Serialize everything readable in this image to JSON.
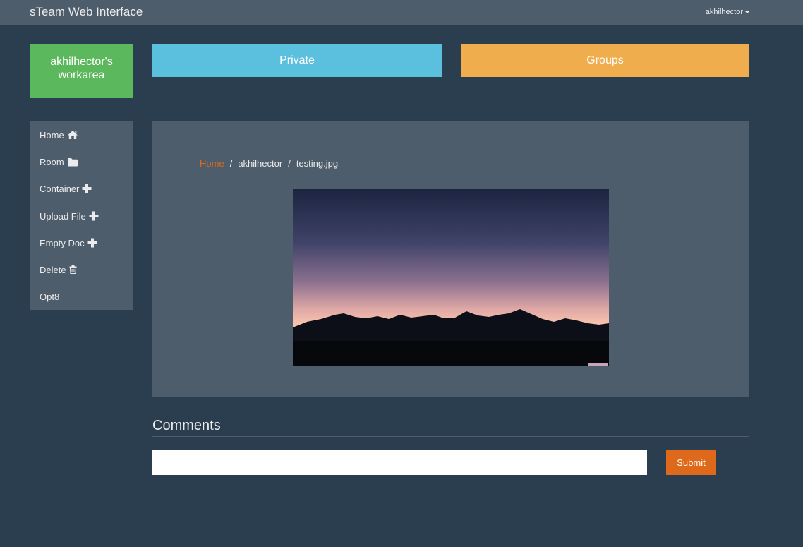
{
  "navbar": {
    "brand": "sTeam Web Interface",
    "user": "akhilhector"
  },
  "workarea": {
    "label": "akhilhector's workarea"
  },
  "tiles": {
    "private": "Private",
    "groups": "Groups"
  },
  "sidebar": {
    "items": [
      {
        "label": "Home",
        "icon": "home-icon"
      },
      {
        "label": "Room",
        "icon": "folder-icon"
      },
      {
        "label": "Container",
        "icon": "plus-icon"
      },
      {
        "label": "Upload File",
        "icon": "plus-icon"
      },
      {
        "label": "Empty Doc",
        "icon": "plus-icon"
      },
      {
        "label": "Delete",
        "icon": "trash-icon"
      },
      {
        "label": "Opt8",
        "icon": ""
      }
    ]
  },
  "breadcrumb": {
    "items": [
      "Home",
      "akhilhector",
      "testing.jpg"
    ],
    "separator": "/"
  },
  "comments": {
    "title": "Comments",
    "input_value": "",
    "submit_label": "Submit"
  },
  "colors": {
    "background": "#2b3e50",
    "panel": "#4e5d6c",
    "workarea": "#5cb85c",
    "private": "#5bc0de",
    "groups": "#f0ad4e",
    "accent": "#df691a"
  }
}
